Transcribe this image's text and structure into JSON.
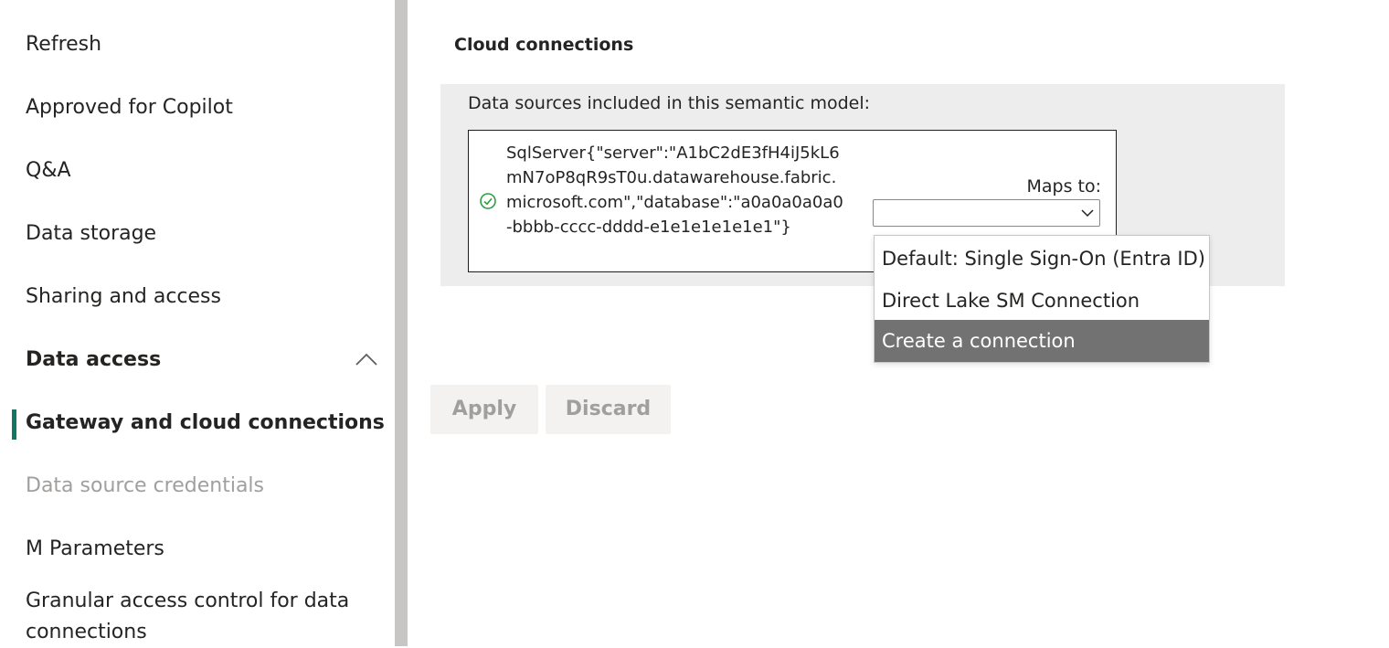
{
  "sidebar": {
    "items": [
      {
        "label": "Refresh"
      },
      {
        "label": "Approved for Copilot"
      },
      {
        "label": "Q&A"
      },
      {
        "label": "Data storage"
      },
      {
        "label": "Sharing and access"
      },
      {
        "label": "Data access",
        "expanded": true
      },
      {
        "label": "Gateway and cloud connections",
        "selected": true
      },
      {
        "label": "Data source credentials",
        "disabled": true
      },
      {
        "label": "M Parameters"
      },
      {
        "label": "Granular access control for data connections"
      }
    ],
    "indicator_color": "#117865",
    "collapse_icon": "chevron-up-icon"
  },
  "main": {
    "section_title": "Cloud connections",
    "panel": {
      "label": "Data sources included in this semantic model:",
      "source": {
        "status_icon": "check-circle-icon",
        "status_color": "#2e9e44",
        "text": "SqlServer{\"server\":\"A1bC2dE3fH4iJ5kL6mN7oP8qR9sT0u.datawarehouse.fabric.microsoft.com\",\"database\":\"a0a0a0a0a0-bbbb-cccc-dddd-e1e1e1e1e1e1\"}"
      },
      "maps_to_label": "Maps to:",
      "select_value": "",
      "dropdown_options": [
        {
          "label": "Default: Single Sign-On (Entra ID)"
        },
        {
          "label": "Direct Lake SM Connection"
        },
        {
          "label": "Create a connection",
          "highlighted": true
        }
      ]
    },
    "buttons": {
      "apply_label": "Apply",
      "discard_label": "Discard",
      "disabled": true
    }
  }
}
